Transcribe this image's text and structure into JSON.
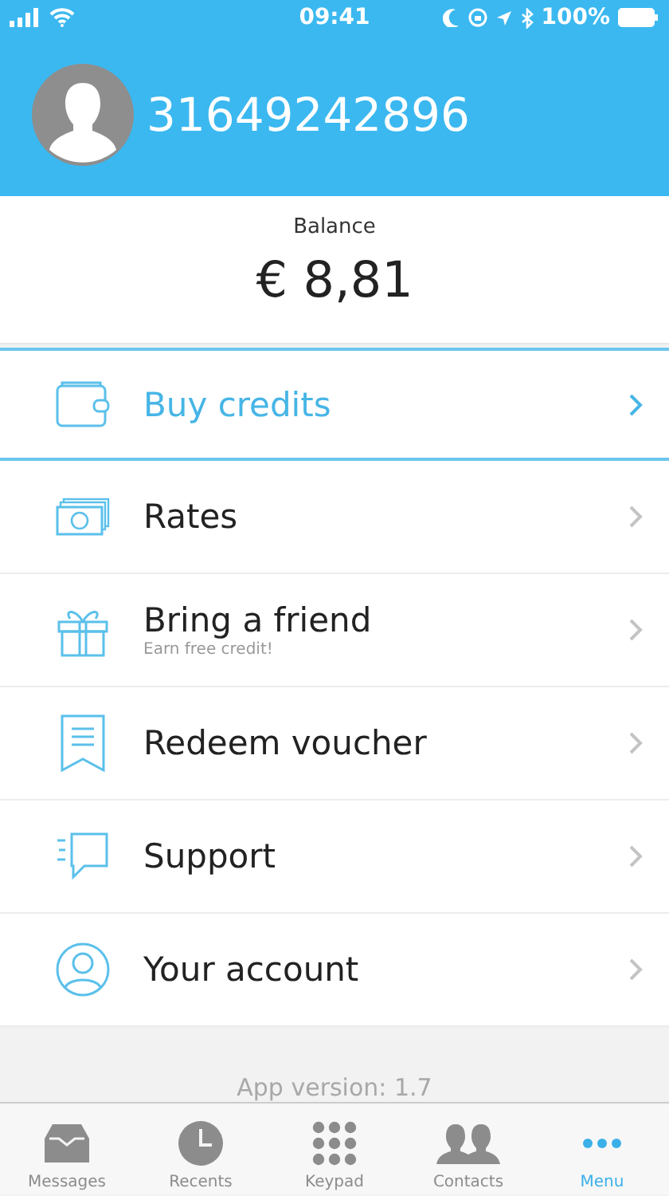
{
  "status_bar": {
    "time": "09:41",
    "battery": "100%"
  },
  "profile": {
    "phone": "31649242896"
  },
  "balance": {
    "label": "Balance",
    "amount": "€ 8,81"
  },
  "menu": [
    {
      "label": "Buy credits",
      "selected": true
    },
    {
      "label": "Rates",
      "selected": false
    },
    {
      "label": "Bring a friend",
      "subtitle": "Earn free credit!",
      "selected": false
    },
    {
      "label": "Redeem voucher",
      "selected": false
    },
    {
      "label": "Support",
      "selected": false
    },
    {
      "label": "Your account",
      "selected": false
    }
  ],
  "footer": {
    "version": "App version: 1.7"
  },
  "tab_bar": [
    {
      "label": "Messages",
      "selected": false
    },
    {
      "label": "Recents",
      "selected": false
    },
    {
      "label": "Keypad",
      "selected": false
    },
    {
      "label": "Contacts",
      "selected": false
    },
    {
      "label": "Menu",
      "selected": true
    }
  ]
}
